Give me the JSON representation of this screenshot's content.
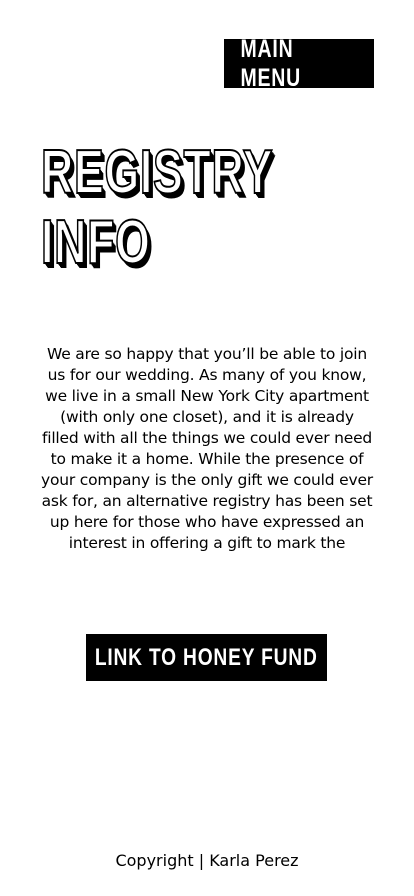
{
  "header": {
    "menu_label": "MAIN MENU"
  },
  "page": {
    "title_line1": "REGISTRY",
    "title_line2": "INFO",
    "intro_text": "We are so happy that you’ll be able to join us for our wedding. As many of you know, we live in a small New York City apartment (with only one closet), and it is already filled with all the things we could ever need to make it a home. While the presence of your company is the only gift we could ever ask for, an alternative registry has been set up here for those who have expressed an interest in offering a gift to mark the"
  },
  "cta": {
    "label": "LINK TO HONEY FUND"
  },
  "footer": {
    "copyright": "Copyright | Karla Perez"
  },
  "colors": {
    "background": "#ffffff",
    "ink": "#000000",
    "button_text": "#ffffff"
  }
}
